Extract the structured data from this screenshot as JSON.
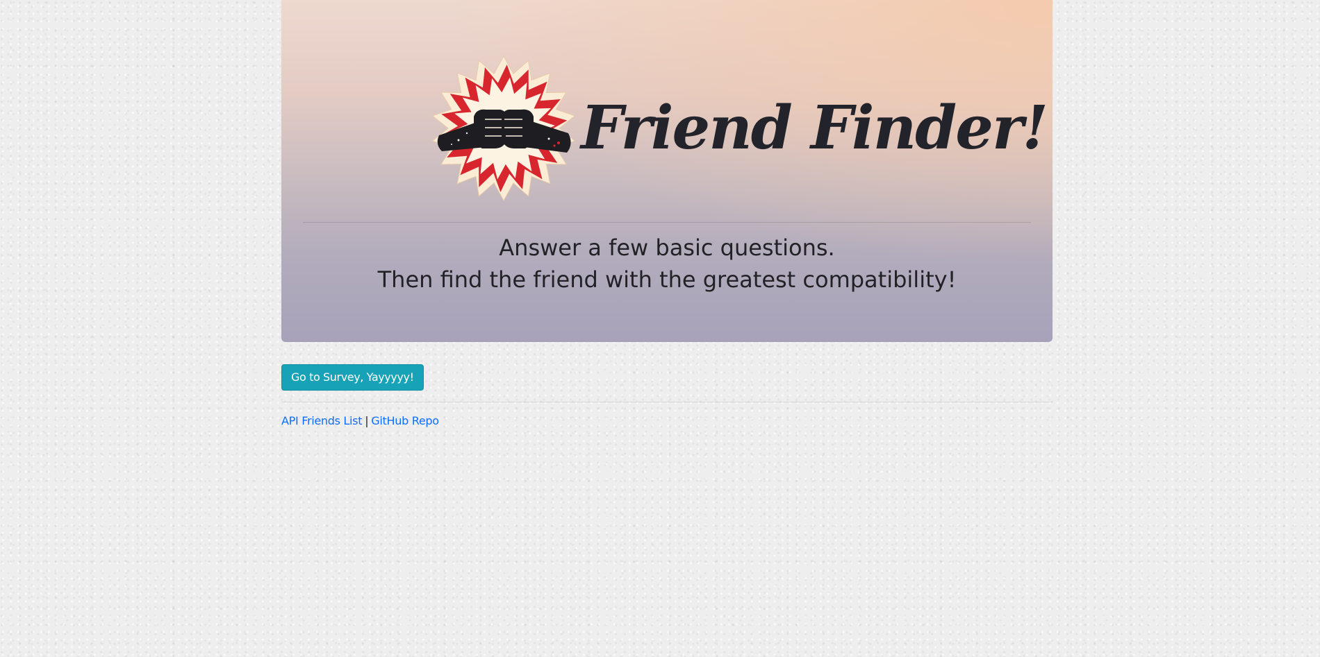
{
  "header": {
    "title": "Friend Finder!",
    "logo_icon": "fist-bump-starburst-icon"
  },
  "tagline": {
    "line1": "Answer a few basic questions.",
    "line2": "Then find the friend with the greatest compatibility!"
  },
  "actions": {
    "survey_button": "Go to Survey, Yayyyyy!"
  },
  "footer": {
    "link_api": "API Friends List",
    "separator": "|",
    "link_github": "GitHub Repo"
  },
  "colors": {
    "button_bg": "#17a2b8",
    "link": "#0d6efd",
    "title_text": "#23232b",
    "star_red": "#d7262e",
    "star_cream": "#fbecd6"
  }
}
